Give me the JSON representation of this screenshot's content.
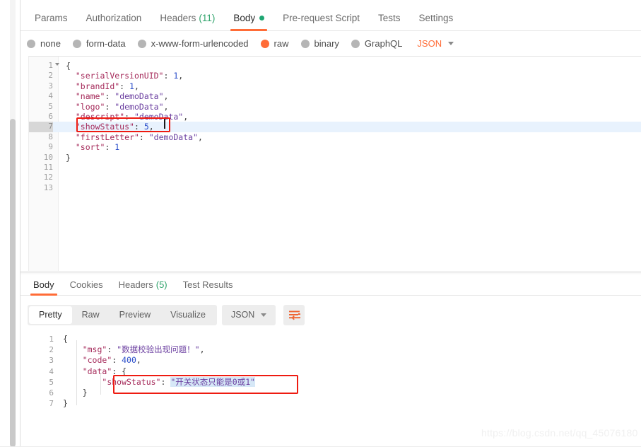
{
  "request": {
    "tabs": [
      {
        "label": "Params",
        "active": false
      },
      {
        "label": "Authorization",
        "active": false
      },
      {
        "label": "Headers",
        "count": "(11)",
        "active": false
      },
      {
        "label": "Body",
        "active": true,
        "dot": true
      },
      {
        "label": "Pre-request Script",
        "active": false
      },
      {
        "label": "Tests",
        "active": false
      },
      {
        "label": "Settings",
        "active": false
      }
    ],
    "body_types": [
      {
        "label": "none",
        "selected": false
      },
      {
        "label": "form-data",
        "selected": false
      },
      {
        "label": "x-www-form-urlencoded",
        "selected": false
      },
      {
        "label": "raw",
        "selected": true
      },
      {
        "label": "binary",
        "selected": false
      },
      {
        "label": "GraphQL",
        "selected": false
      }
    ],
    "format_selected": "JSON",
    "editor": {
      "active_line": 7,
      "total_lines": 13,
      "lines": [
        {
          "n": "1",
          "text": "{"
        },
        {
          "n": "2",
          "text": "    \"serialVersionUID\": 1,"
        },
        {
          "n": "3",
          "text": "    \"brandId\": 1,"
        },
        {
          "n": "4",
          "text": "    \"name\": \"demoData\","
        },
        {
          "n": "5",
          "text": "    \"logo\": \"demoData\","
        },
        {
          "n": "6",
          "text": "    \"descript\": \"demoData\","
        },
        {
          "n": "7",
          "text": "    \"showStatus\": 5,"
        },
        {
          "n": "8",
          "text": "    \"firstLetter\": \"demoData\","
        },
        {
          "n": "9",
          "text": "    \"sort\": 1"
        },
        {
          "n": "10",
          "text": "}"
        },
        {
          "n": "11",
          "text": ""
        },
        {
          "n": "12",
          "text": ""
        },
        {
          "n": "13",
          "text": ""
        }
      ]
    }
  },
  "response": {
    "tabs": [
      {
        "label": "Body",
        "active": true
      },
      {
        "label": "Cookies",
        "active": false
      },
      {
        "label": "Headers",
        "count": "(5)",
        "active": false
      },
      {
        "label": "Test Results",
        "active": false
      }
    ],
    "view_modes": [
      {
        "label": "Pretty",
        "active": true
      },
      {
        "label": "Raw",
        "active": false
      },
      {
        "label": "Preview",
        "active": false
      },
      {
        "label": "Visualize",
        "active": false
      }
    ],
    "format_selected": "JSON",
    "wrap_icon": "word-wrap-icon",
    "body": {
      "lines": [
        {
          "n": "1",
          "text": "{"
        },
        {
          "n": "2",
          "text": "    \"msg\": \"数据校验出现问题！\","
        },
        {
          "n": "3",
          "text": "    \"code\": 400,"
        },
        {
          "n": "4",
          "text": "    \"data\": {"
        },
        {
          "n": "5",
          "text": "        \"showStatus\": \"开关状态只能是0或1\""
        },
        {
          "n": "6",
          "text": "    }"
        },
        {
          "n": "7",
          "text": "}"
        }
      ],
      "msg_key": "\"msg\"",
      "msg_value": "\"数据校验出现问题！\"",
      "code_key": "\"code\"",
      "code_value": "400",
      "data_key": "\"data\"",
      "show_status_key": "\"showStatus\"",
      "show_status_value": "\"开关状态只能是0或1\""
    }
  },
  "annotations": {
    "request_highlight_label": "showStatus-request-highlight",
    "response_highlight_label": "showStatus-response-highlight"
  },
  "watermark": "https://blog.csdn.net/qq_45076180",
  "colors": {
    "accent": "#ff6c37",
    "annotation_red": "#ee1b11",
    "dot_green": "#1ea672",
    "count_green": "#30a46c",
    "active_line": "#e8f2fd",
    "selection": "#d6e8f7"
  }
}
